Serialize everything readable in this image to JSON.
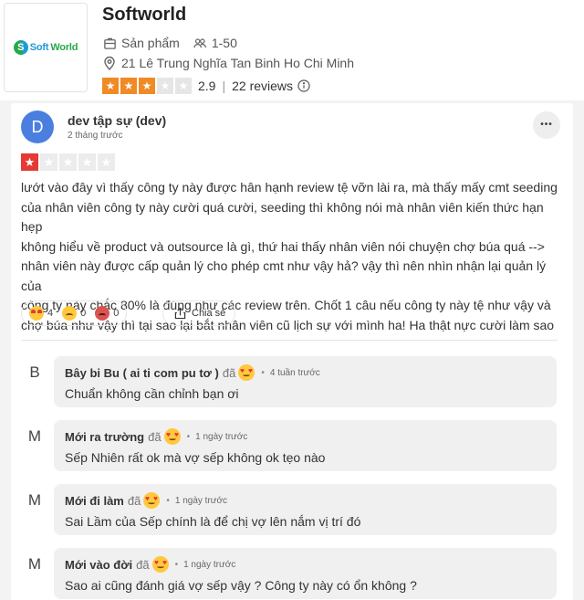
{
  "company": {
    "logo_text_soft": "Soft",
    "logo_text_world": "World",
    "logo_letter": "S",
    "name": "Softworld",
    "category": "Sản phẩm",
    "size": "1-50",
    "address": "21 Lê Trung Nghĩa Tan Binh Ho Chi Minh",
    "rating": "2.9",
    "rating_stars": 3,
    "separator": "|",
    "reviews": "22 reviews"
  },
  "review": {
    "avatar_letter": "D",
    "author": "dev tập sự (dev)",
    "time": "2 tháng trước",
    "stars": 1,
    "more_label": "•••",
    "lines": [
      "lướt vào đây vì thấy công ty này được hân hạnh review tệ vỡn lài ra, mà thấy mấy cmt seeding",
      "của nhân viên công ty này cười quá cười, seeding thì không nói mà nhân viên kiến thức hạn hẹp",
      "không hiểu về product và outsource là gì, thứ hai thấy nhân viên nói chuyện chợ búa quá -->",
      "nhân viên này được cấp quản lý cho phép cmt như vậy hả? vậy thì nên nhìn nhận lại quản lý của",
      "công ty này chắc 80% là đúng như các review trên. Chốt 1 câu nếu công ty này tệ như vậy và",
      "chợ búa như vậy thì tại sao lại bắt nhân viên cũ lịch sự với mình ha! Ha thật nực cười làm sao"
    ],
    "reactions": [
      {
        "icon": "heart-eyes",
        "count": "4"
      },
      {
        "icon": "sad",
        "count": "0"
      },
      {
        "icon": "angry",
        "count": "0"
      }
    ],
    "share_label": "Chia sẻ"
  },
  "comments": [
    {
      "avatar": "B",
      "name": "Bây bi Bu ( ai ti com pu tơ )",
      "da": "đã",
      "dot": "•",
      "time": "4 tuần trước",
      "text": "Chuẩn không cần chỉnh bạn ơi"
    },
    {
      "avatar": "M",
      "name": "Mới ra trường",
      "da": "đã",
      "dot": "•",
      "time": "1 ngày trước",
      "text": "Sếp Nhiên rất ok mà vợ sếp không ok tẹo nào"
    },
    {
      "avatar": "M",
      "name": "Mới đi làm",
      "da": "đã",
      "dot": "•",
      "time": "1 ngày trước",
      "text": "Sai Lầm của Sếp chính là để chị vợ lên nắm vị trí đó"
    },
    {
      "avatar": "M",
      "name": "Mới vào đời",
      "da": "đã",
      "dot": "•",
      "time": "1 ngày trước",
      "text": "Sao ai cũng đánh giá vợ sếp vậy ? Công ty này có ổn không ?"
    }
  ],
  "colors": {
    "accent_orange": "#f08a24",
    "review_star_red": "#e53935",
    "avatar_blue": "#4a7fe0"
  }
}
